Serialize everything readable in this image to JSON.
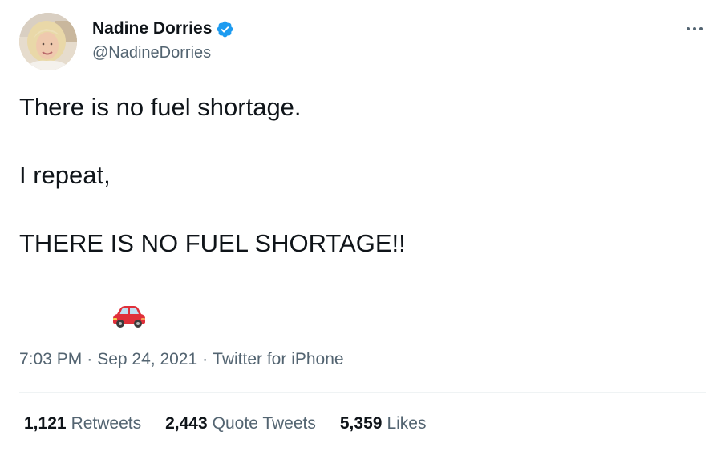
{
  "author": {
    "display_name": "Nadine Dorries",
    "handle": "@NadineDorries",
    "verified": true,
    "avatar_icon": "profile-photo",
    "verified_icon": "verified-badge-icon"
  },
  "tweet": {
    "line1": "There is no fuel shortage.",
    "line2": "I repeat,",
    "line3": "THERE IS NO FUEL SHORTAGE!!",
    "emoji": "red-car-emoji"
  },
  "meta": {
    "time": "7:03 PM",
    "separator": "·",
    "date": "Sep 24, 2021",
    "source": "Twitter for iPhone"
  },
  "stats": {
    "retweets_count": "1,121",
    "retweets_label": "Retweets",
    "quotes_count": "2,443",
    "quotes_label": "Quote Tweets",
    "likes_count": "5,359",
    "likes_label": "Likes"
  },
  "colors": {
    "text": "#0f1419",
    "secondary": "#536471",
    "verified": "#1d9bf0",
    "divider": "#eff3f4",
    "car": "#e0303a"
  }
}
